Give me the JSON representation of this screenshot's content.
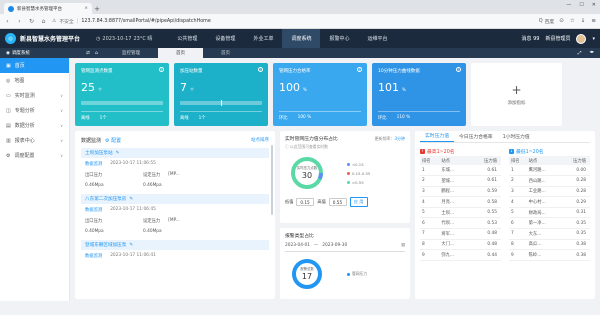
{
  "browser": {
    "tab_title": "新县智慧水务管理平台",
    "tab_close": "×",
    "new_tab": "+",
    "insecure_label": "不安全",
    "url": "123.7.84.3:8877/smallPortal/#/pipeApi/dispatchHome",
    "search_placeholder": "百度"
  },
  "header": {
    "app_title": "新县智慧水务管理平台",
    "date_text": "2023-10-17",
    "weather_text": "23°C 晴",
    "nav": [
      "公共管理",
      "设备管理",
      "外业工单",
      "调度系统",
      "报警中心",
      "运维平台"
    ],
    "active_nav_index": 3,
    "message_label": "消息",
    "message_count": "99",
    "user_name": "新县管理员"
  },
  "subheader": {
    "system_name": "调度系统",
    "tabs": [
      "监控管理",
      "首页",
      "首页"
    ],
    "active_tab_index": 1
  },
  "sidebar": {
    "items": [
      {
        "label": "首页",
        "icon": "home-icon",
        "active": true,
        "has_children": false
      },
      {
        "label": "地图",
        "icon": "map-icon",
        "active": false,
        "has_children": false
      },
      {
        "label": "实时监测",
        "icon": "monitor-icon",
        "active": false,
        "has_children": true
      },
      {
        "label": "专题分析",
        "icon": "topic-icon",
        "active": false,
        "has_children": true
      },
      {
        "label": "数据分析",
        "icon": "data-icon",
        "active": false,
        "has_children": true
      },
      {
        "label": "报表中心",
        "icon": "report-icon",
        "active": false,
        "has_children": true
      },
      {
        "label": "调度配置",
        "icon": "config-icon",
        "active": false,
        "has_children": true
      }
    ]
  },
  "cards": [
    {
      "title": "管网监测点数量",
      "value": "25",
      "unit": "个",
      "progress": 0,
      "foot": [
        "离线",
        "1个"
      ],
      "color": "#23bfc9"
    },
    {
      "title": "加压站数量",
      "value": "7",
      "unit": "个",
      "progress": 0.5,
      "foot": [
        "离线",
        "1个"
      ],
      "color": "#1db0c9"
    },
    {
      "title": "管网压力合格率",
      "value": "100",
      "unit": "%",
      "progress": null,
      "foot": [
        "环比",
        "100 %"
      ],
      "color": "#3aa8ee"
    },
    {
      "title": "10分钟压力曲线数据",
      "value": "101",
      "unit": "%",
      "progress": null,
      "foot": [
        "环比",
        "110 %"
      ],
      "color": "#2f94e6"
    }
  ],
  "add_card": {
    "label": "添加指标"
  },
  "monitor": {
    "title": "数据监测",
    "config_label": "配置",
    "sort_label": "站点排序",
    "sites": [
      {
        "name": "土坝加压泵站",
        "section": "数据监测",
        "datetime": "2023-10-17 11:06:55",
        "inlet_label": "出口压力",
        "setpoint_label": "设定压力",
        "setpoint_value": "[MP...",
        "inlet_value": "0.46Mpa",
        "setpoint_unit": "0.46Mpa"
      },
      {
        "name": "八东第二次加压泵房",
        "section": "数据监测",
        "datetime": "2023-10-17 11:06:45",
        "inlet_label": "出口压力",
        "setpoint_label": "设定压力",
        "setpoint_value": "[MP...",
        "inlet_value": "0.40Mpa",
        "setpoint_unit": "0.40Mpa"
      },
      {
        "name": "登城东朝区域加压泵",
        "section": "数据监测",
        "datetime": "2023-10-17 11:06:41",
        "inlet_label": "",
        "setpoint_label": "",
        "setpoint_value": "",
        "inlet_value": "",
        "setpoint_unit": ""
      }
    ]
  },
  "pressure_ratio": {
    "title": "实时管网压力值分布占比",
    "refresh_label": "更新频率：",
    "refresh_value": "3分钟",
    "note": "以此范围可查看实时数",
    "center_label": "实时压力点数",
    "center_value": "30",
    "legend": [
      {
        "label": "<0.15",
        "color": "#5b8ff9"
      },
      {
        "label": "0.15-0.55",
        "color": "#e86452"
      },
      {
        "label": ">0.55",
        "color": "#5ad8a6"
      }
    ],
    "range": {
      "low_label": "低值",
      "low": "0.15",
      "high_label": "高值",
      "high": "0.55",
      "apply": "应 用"
    }
  },
  "alarm_type": {
    "title": "报警类型占比",
    "date_from": "2023-04-01",
    "date_sep": "—",
    "date_to": "2023-09-30",
    "center_label": "报警总数",
    "center_value": "17",
    "legend": [
      {
        "label": "管网压力",
        "color": "#2196f3"
      }
    ]
  },
  "rank": {
    "tabs": [
      "实时压力值",
      "今日压力合格率",
      "1小时压力值"
    ],
    "active_tab": 0,
    "high": {
      "title": "最高1~20名",
      "icon": "↑",
      "cols": [
        "排名",
        "站点",
        "压力值"
      ],
      "rows": [
        [
          "1",
          "东城…",
          "0.61"
        ],
        [
          "2",
          "望城…",
          "0.61"
        ],
        [
          "3",
          "鹏程…",
          "0.59"
        ],
        [
          "4",
          "月亮…",
          "0.58"
        ],
        [
          "5",
          "土坝…",
          "0.55"
        ],
        [
          "6",
          "代坝…",
          "0.53"
        ],
        [
          "7",
          "将军…",
          "0.48"
        ],
        [
          "8",
          "大门…",
          "0.48"
        ],
        [
          "9",
          "弥九…",
          "0.44"
        ]
      ]
    },
    "low": {
      "title": "最低1~20名",
      "icon": "↓",
      "cols": [
        "排名",
        "站点",
        "压力值"
      ],
      "rows": [
        [
          "1",
          "鹰河路…",
          "0.00"
        ],
        [
          "2",
          "西山路…",
          "0.28"
        ],
        [
          "3",
          "工业路…",
          "0.28"
        ],
        [
          "4",
          "中心村…",
          "0.29"
        ],
        [
          "5",
          "财政局…",
          "0.31"
        ],
        [
          "6",
          "第一净…",
          "0.35"
        ],
        [
          "7",
          "大东…",
          "0.35"
        ],
        [
          "8",
          "高瓜…",
          "0.38"
        ],
        [
          "9",
          "陈岭…",
          "0.38"
        ]
      ]
    }
  }
}
